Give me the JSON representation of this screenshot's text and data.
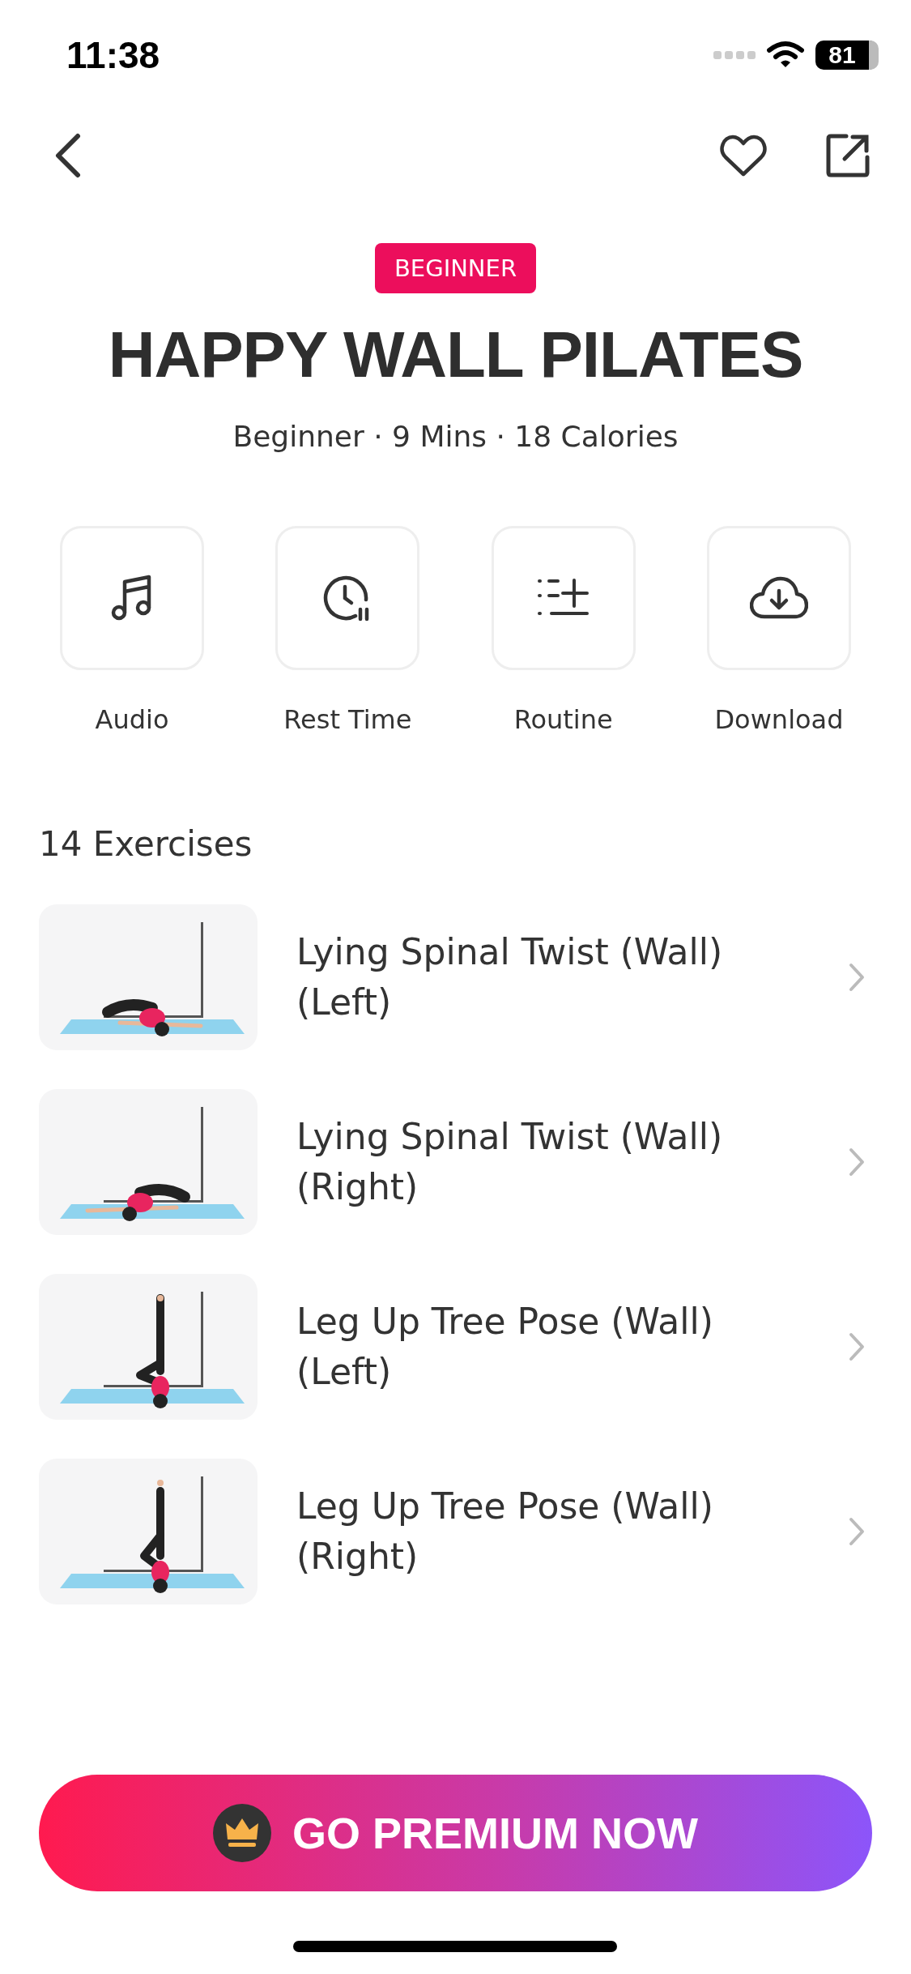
{
  "status_bar": {
    "time": "11:38",
    "battery": "81"
  },
  "badge": "BEGINNER",
  "title": "HAPPY WALL PILATES",
  "subtitle": "Beginner · 9 Mins · 18 Calories",
  "actions": [
    {
      "kind": "audio",
      "label": "Audio"
    },
    {
      "kind": "rest",
      "label": "Rest Time"
    },
    {
      "kind": "routine",
      "label": "Routine"
    },
    {
      "kind": "download",
      "label": "Download"
    }
  ],
  "exercise_count": "14 Exercises",
  "exercises": [
    {
      "title": "Lying Spinal Twist (Wall) (Left)"
    },
    {
      "title": "Lying Spinal Twist (Wall) (Right)"
    },
    {
      "title": "Leg Up Tree Pose (Wall) (Left)"
    },
    {
      "title": "Leg Up Tree Pose (Wall) (Right)"
    }
  ],
  "premium_button": "GO PREMIUM NOW"
}
